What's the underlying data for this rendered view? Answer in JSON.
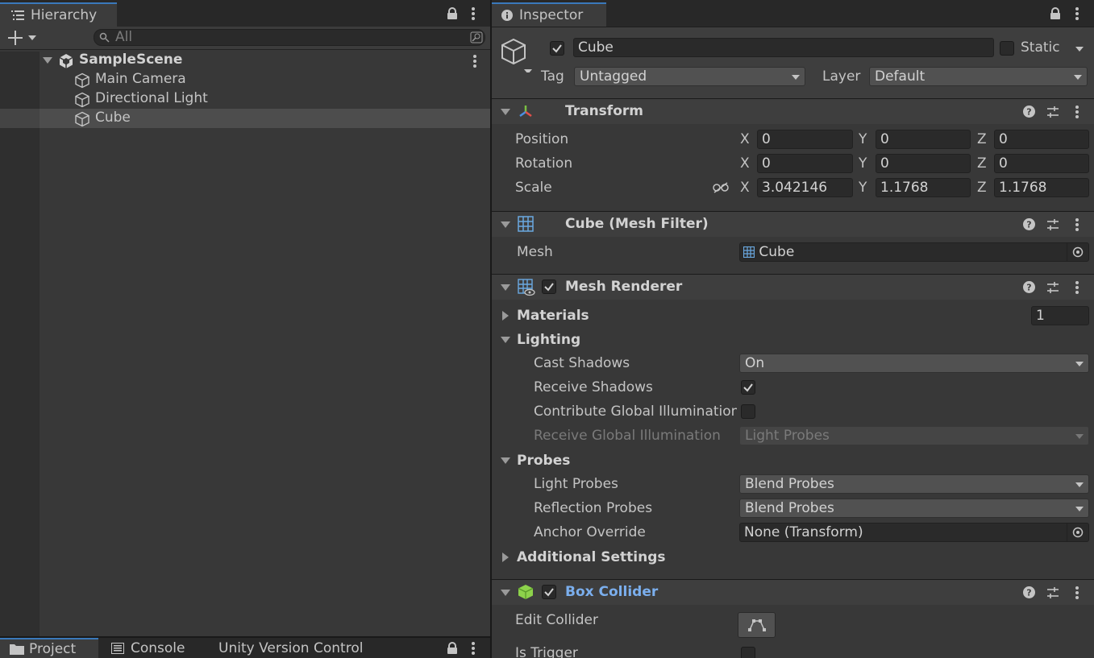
{
  "hierarchy": {
    "tab_label": "Hierarchy",
    "search_placeholder": "All",
    "scene": "SampleScene",
    "items": [
      {
        "label": "Main Camera"
      },
      {
        "label": "Directional Light"
      },
      {
        "label": "Cube"
      }
    ],
    "selected_index": 2
  },
  "bottom_tabs": {
    "project": "Project",
    "console": "Console",
    "vcs": "Unity Version Control"
  },
  "inspector": {
    "tab_label": "Inspector",
    "object_name": "Cube",
    "active": true,
    "static_label": "Static",
    "tag_label": "Tag",
    "tag_value": "Untagged",
    "layer_label": "Layer",
    "layer_value": "Default",
    "transform": {
      "title": "Transform",
      "position_label": "Position",
      "rotation_label": "Rotation",
      "scale_label": "Scale",
      "axis_x": "X",
      "axis_y": "Y",
      "axis_z": "Z",
      "position": {
        "x": "0",
        "y": "0",
        "z": "0"
      },
      "rotation": {
        "x": "0",
        "y": "0",
        "z": "0"
      },
      "scale": {
        "x": "3.042146",
        "y": "1.1768",
        "z": "1.1768"
      }
    },
    "mesh_filter": {
      "title": "Cube (Mesh Filter)",
      "mesh_label": "Mesh",
      "mesh_value": "Cube"
    },
    "mesh_renderer": {
      "title": "Mesh Renderer",
      "enabled": true,
      "materials_label": "Materials",
      "materials_count": "1",
      "lighting_label": "Lighting",
      "cast_shadows_label": "Cast Shadows",
      "cast_shadows_value": "On",
      "receive_shadows_label": "Receive Shadows",
      "receive_shadows": true,
      "contribute_gi_label": "Contribute Global Illumination",
      "contribute_gi": false,
      "receive_gi_label": "Receive Global Illumination",
      "receive_gi_value": "Light Probes",
      "probes_label": "Probes",
      "light_probes_label": "Light Probes",
      "light_probes_value": "Blend Probes",
      "reflection_probes_label": "Reflection Probes",
      "reflection_probes_value": "Blend Probes",
      "anchor_override_label": "Anchor Override",
      "anchor_override_value": "None (Transform)",
      "additional_settings_label": "Additional Settings"
    },
    "box_collider": {
      "title": "Box Collider",
      "enabled": true,
      "edit_collider_label": "Edit Collider",
      "is_trigger_label": "Is Trigger"
    }
  },
  "colors": {
    "panel_bg": "#383838",
    "accent_blue": "#3a79bb",
    "link_blue": "#7bafee",
    "collider_green": "#8dd24b"
  }
}
